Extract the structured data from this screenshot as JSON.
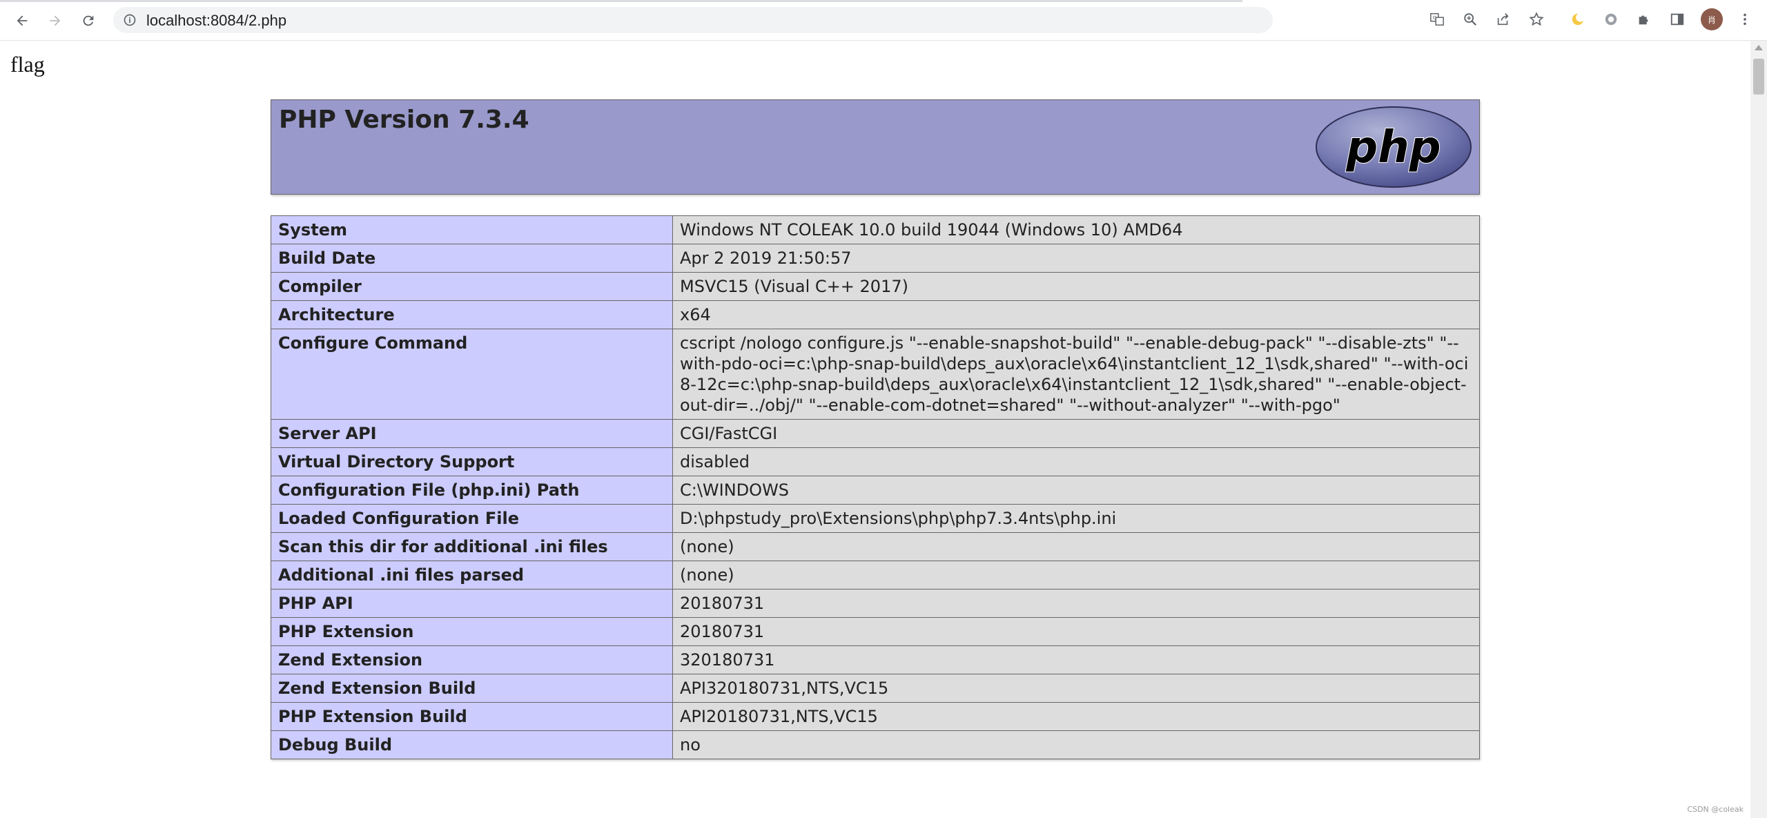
{
  "browser": {
    "url": "localhost:8084/2.php",
    "avatar_initial": "肖"
  },
  "page": {
    "flag_text": "flag",
    "php_title": "PHP Version 7.3.4",
    "logo_text": "php"
  },
  "info_rows": [
    {
      "label": "System",
      "value": "Windows NT COLEAK 10.0 build 19044 (Windows 10) AMD64"
    },
    {
      "label": "Build Date",
      "value": "Apr 2 2019 21:50:57"
    },
    {
      "label": "Compiler",
      "value": "MSVC15 (Visual C++ 2017)"
    },
    {
      "label": "Architecture",
      "value": "x64"
    },
    {
      "label": "Configure Command",
      "value": "cscript /nologo configure.js \"--enable-snapshot-build\" \"--enable-debug-pack\" \"--disable-zts\" \"--with-pdo-oci=c:\\php-snap-build\\deps_aux\\oracle\\x64\\instantclient_12_1\\sdk,shared\" \"--with-oci8-12c=c:\\php-snap-build\\deps_aux\\oracle\\x64\\instantclient_12_1\\sdk,shared\" \"--enable-object-out-dir=../obj/\" \"--enable-com-dotnet=shared\" \"--without-analyzer\" \"--with-pgo\""
    },
    {
      "label": "Server API",
      "value": "CGI/FastCGI"
    },
    {
      "label": "Virtual Directory Support",
      "value": "disabled"
    },
    {
      "label": "Configuration File (php.ini) Path",
      "value": "C:\\WINDOWS"
    },
    {
      "label": "Loaded Configuration File",
      "value": "D:\\phpstudy_pro\\Extensions\\php\\php7.3.4nts\\php.ini"
    },
    {
      "label": "Scan this dir for additional .ini files",
      "value": "(none)"
    },
    {
      "label": "Additional .ini files parsed",
      "value": "(none)"
    },
    {
      "label": "PHP API",
      "value": "20180731"
    },
    {
      "label": "PHP Extension",
      "value": "20180731"
    },
    {
      "label": "Zend Extension",
      "value": "320180731"
    },
    {
      "label": "Zend Extension Build",
      "value": "API320180731,NTS,VC15"
    },
    {
      "label": "PHP Extension Build",
      "value": "API20180731,NTS,VC15"
    },
    {
      "label": "Debug Build",
      "value": "no"
    }
  ],
  "watermark": "CSDN @coleak",
  "colors": {
    "header_bg": "#9999cc",
    "label_bg": "#ccccff",
    "value_bg": "#dddddd"
  }
}
